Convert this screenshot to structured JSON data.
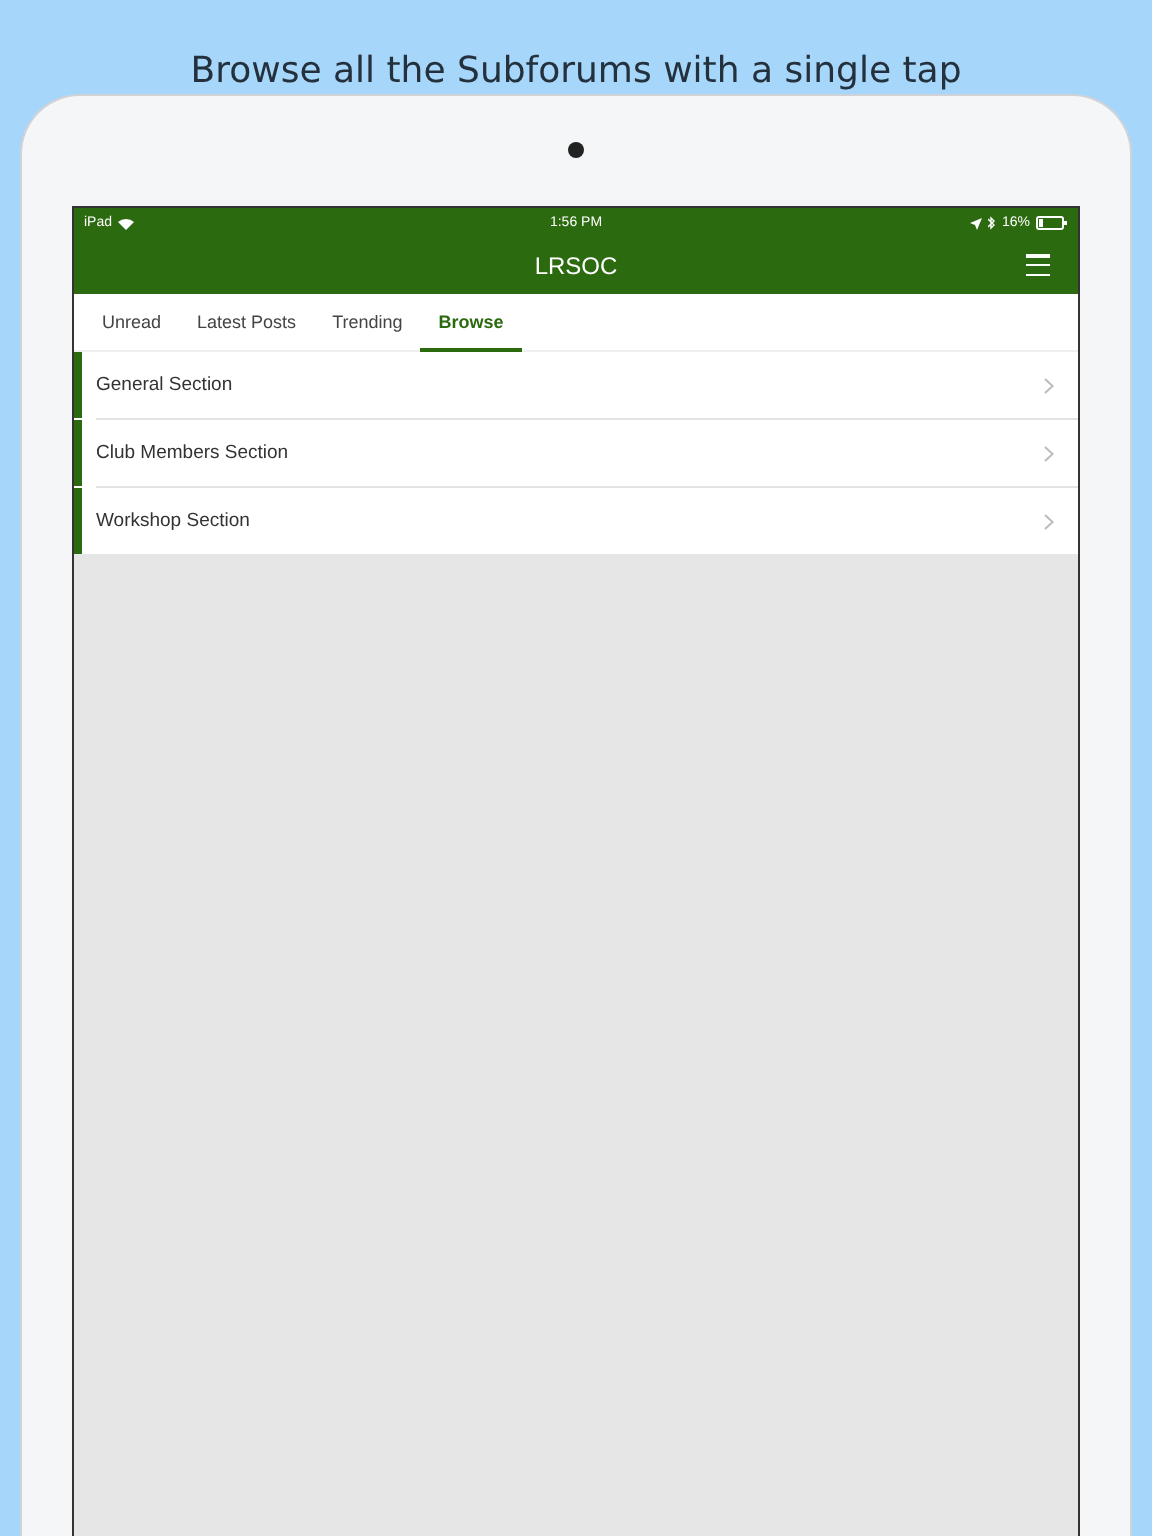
{
  "caption": "Browse all the Subforums with a single tap",
  "status_bar": {
    "carrier": "iPad",
    "time": "1:56 PM",
    "battery": "16%"
  },
  "nav": {
    "title": "LRSOC"
  },
  "tabs": [
    {
      "label": "Unread",
      "selected": false
    },
    {
      "label": "Latest Posts",
      "selected": false
    },
    {
      "label": "Trending",
      "selected": false
    },
    {
      "label": "Browse",
      "selected": true
    }
  ],
  "sections": [
    {
      "name": "General Section"
    },
    {
      "name": "Club Members Section"
    },
    {
      "name": "Workshop Section"
    }
  ]
}
